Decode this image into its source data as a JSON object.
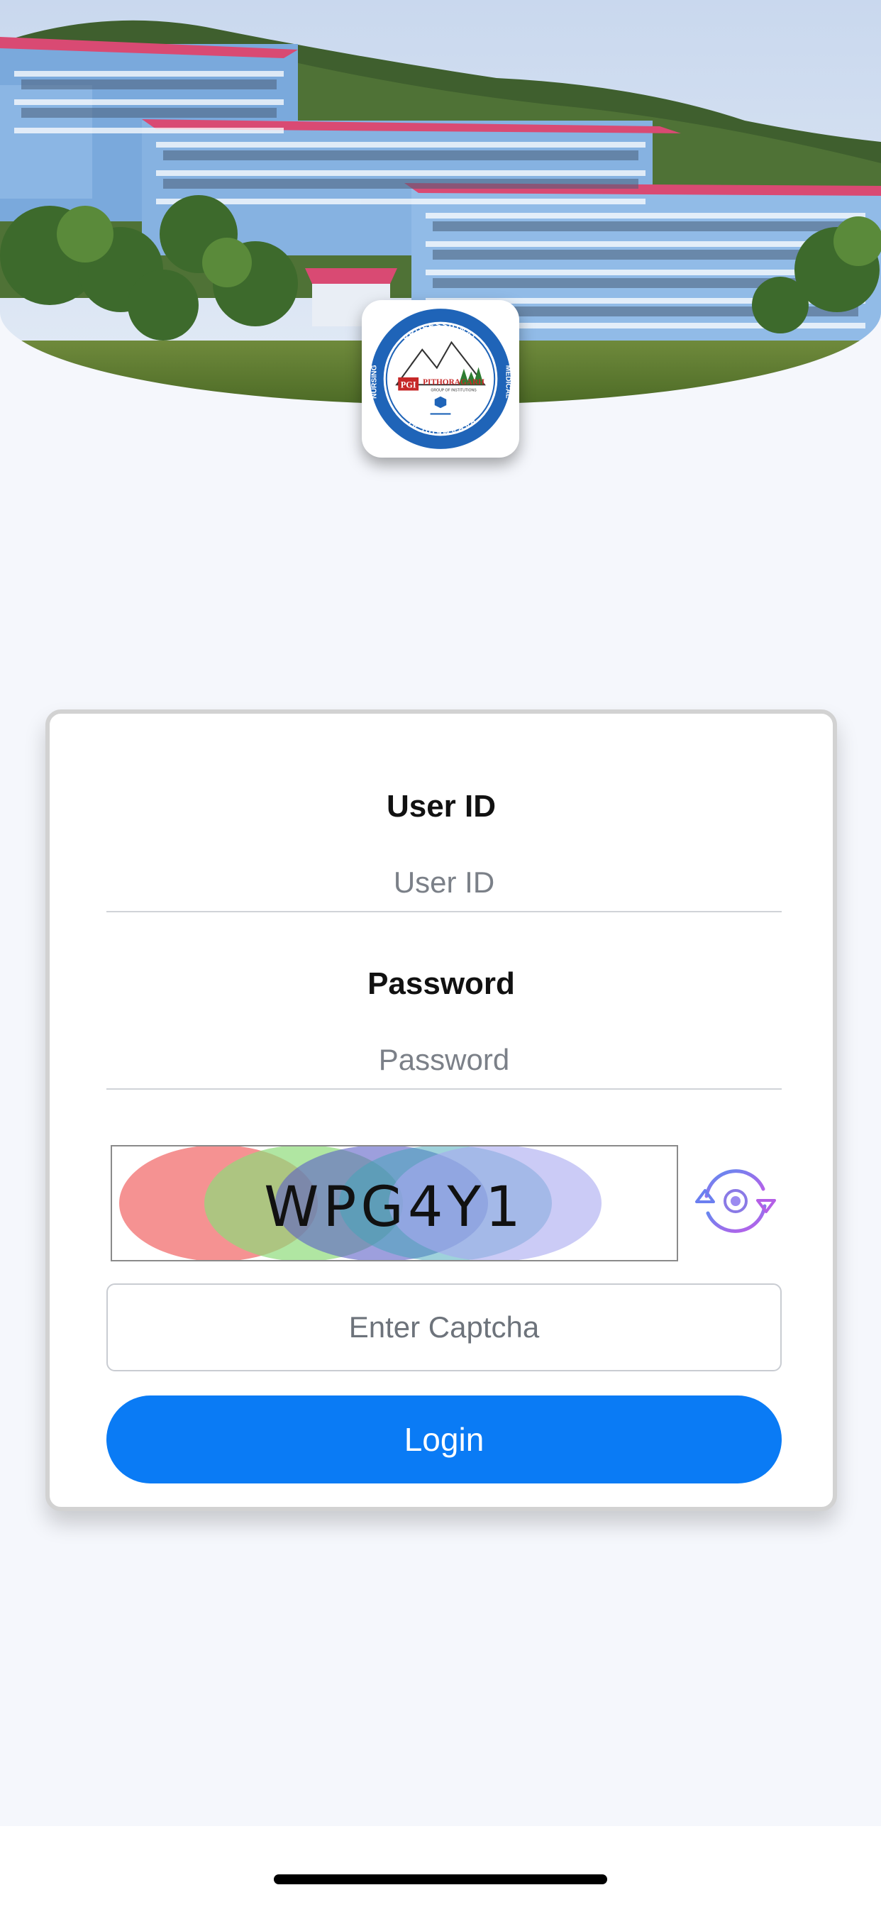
{
  "header": {
    "logo": {
      "name": "pgi-pithoragarh-logo",
      "abbr": "PGI",
      "title": "PITHORAGARH",
      "subtitle": "GROUP OF INSTITUTIONS",
      "ring_text": [
        "PROFESSIONAL",
        "MEDICAL",
        "PARAMEDICAL",
        "NURSING"
      ],
      "ring_color": "#1565c0"
    }
  },
  "login_form": {
    "user_id_label": "User ID",
    "user_id_placeholder": "User ID",
    "user_id_value": "",
    "password_label": "Password",
    "password_placeholder": "Password",
    "password_value": "",
    "captcha_text": "WPG4Y1",
    "captcha_input_placeholder": "Enter Captcha",
    "captcha_input_value": "",
    "refresh_icon": "refresh-icon",
    "login_label": "Login"
  },
  "colors": {
    "accent": "#0a7bf5",
    "background": "#f5f7fc"
  }
}
